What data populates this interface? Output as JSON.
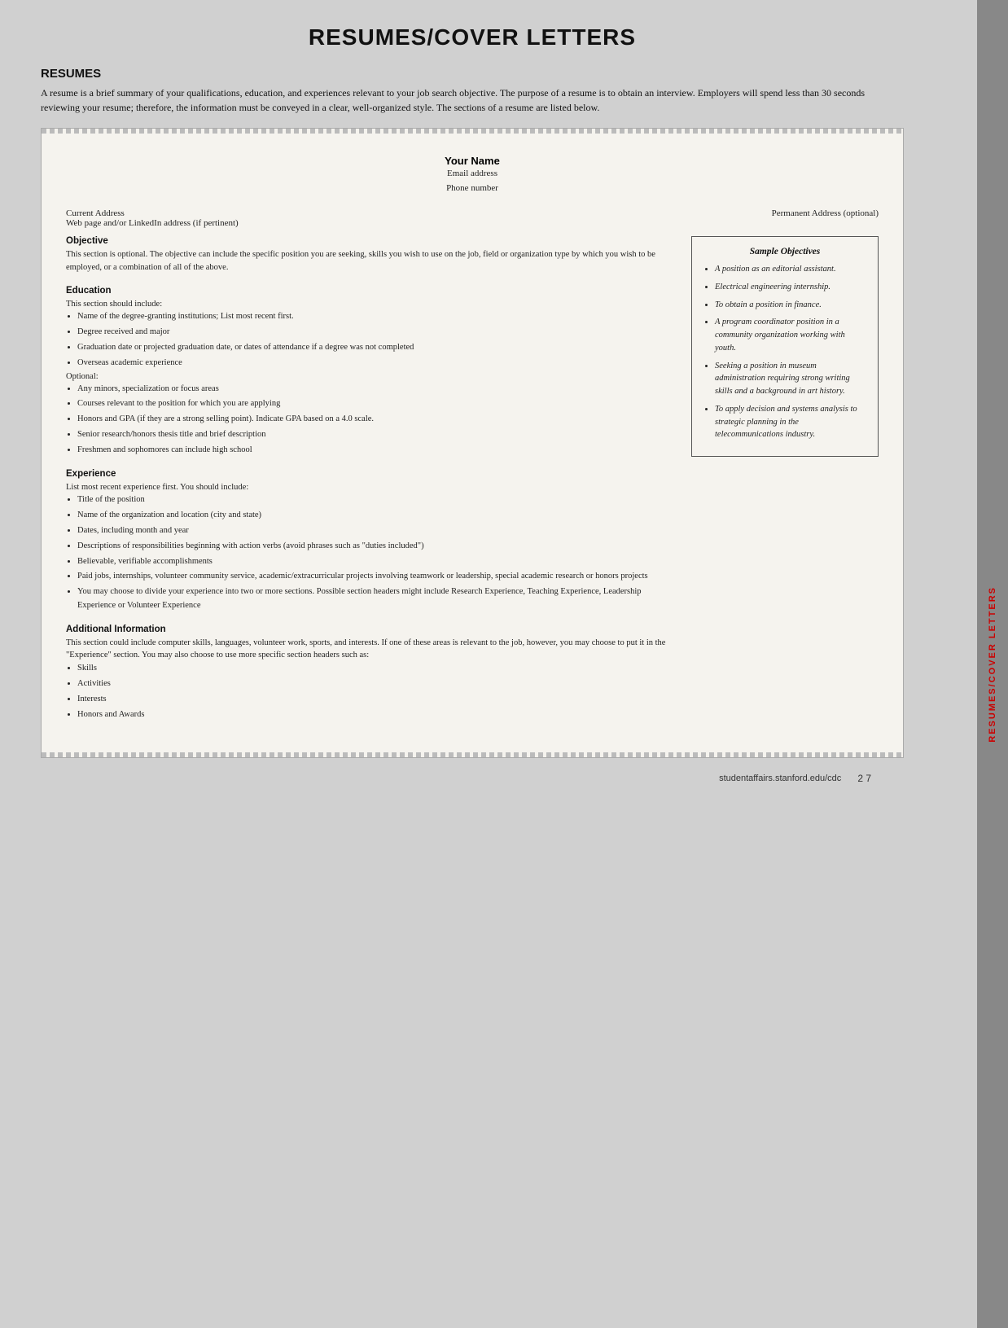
{
  "page": {
    "title": "RESUMES/COVER LETTERS",
    "sidebar_label": "RESUMES/COVER LETTERS",
    "footer_url": "studentaffairs.stanford.edu/cdc",
    "footer_page": "2  7"
  },
  "intro": {
    "section_heading": "RESUMES",
    "paragraph": "A resume is a brief summary of your qualifications, education, and experiences relevant to your job search objective. The purpose of a resume is to obtain an interview. Employers will spend less than 30 seconds reviewing your resume; therefore, the information must be conveyed in a clear, well-organized style. The sections of a resume are listed below."
  },
  "resume_template": {
    "name": "Your Name",
    "email": "Email address",
    "phone": "Phone number",
    "current_address": "Current Address",
    "web_address": "Web page and/or LinkedIn address (if pertinent)",
    "permanent_address": "Permanent Address (optional)"
  },
  "sections": {
    "objective": {
      "title": "Objective",
      "text": "This section is optional. The objective can include the specific position you are seeking, skills you wish to use on the job, field or organization type by which you wish to be employed, or a combination of all of the above."
    },
    "education": {
      "title": "Education",
      "intro": "This section should include:",
      "items": [
        "Name of the degree-granting institutions; List most recent first.",
        "Degree received and major",
        "Graduation date or projected graduation date, or dates of attendance if a degree was not completed",
        "Overseas academic experience"
      ],
      "optional_label": "Optional:",
      "optional_items": [
        "Any minors, specialization or focus areas",
        "Courses relevant to the position for which you are applying",
        "Honors and GPA (if they are a strong selling point). Indicate GPA based on a 4.0 scale.",
        "Senior research/honors thesis title and brief description",
        "Freshmen and sophomores can include high school"
      ]
    },
    "experience": {
      "title": "Experience",
      "intro": "List most recent experience first. You should include:",
      "items": [
        "Title of the position",
        "Name of the organization and location (city and state)",
        "Dates, including month and year",
        "Descriptions of responsibilities beginning with action verbs (avoid phrases such as \"duties included\")",
        "Believable, verifiable accomplishments",
        "Paid jobs, internships, volunteer community service, academic/extracurricular projects involving teamwork or leadership, special academic research or honors projects",
        "You may choose to divide your experience into two or more sections. Possible section headers might include Research Experience, Teaching Experience, Leadership Experience or Volunteer Experience"
      ]
    },
    "additional_information": {
      "title": "Additional Information",
      "text": "This section could include computer skills, languages, volunteer work, sports, and interests. If one of these areas is relevant to the job, however, you may choose to put it in the \"Experience\" section. You may also choose to use more specific section headers such as:",
      "items": [
        "Skills",
        "Activities",
        "Interests",
        "Honors and Awards"
      ]
    }
  },
  "sample_objectives": {
    "title": "Sample Objectives",
    "items": [
      "A position as an editorial assistant.",
      "Electrical engineering internship.",
      "To obtain a position in finance.",
      "A program coordinator position in a community organization working with youth.",
      "Seeking a position in museum administration requiring strong writing skills and a background in art history.",
      "To apply decision and systems analysis to strategic planning in the telecommunications industry."
    ]
  }
}
